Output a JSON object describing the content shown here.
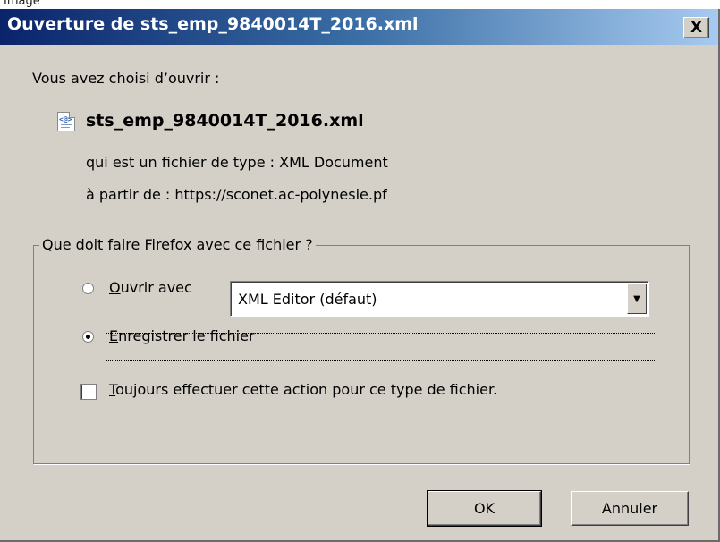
{
  "window": {
    "partial_label": "Image",
    "title": "Ouverture de sts_emp_9840014T_2016.xml",
    "close_glyph": "X"
  },
  "intro": "Vous avez choisi d’ouvrir :",
  "file": {
    "icon": "xml-file-icon",
    "icon_glyph": "<@>",
    "name": "sts_emp_9840014T_2016.xml",
    "type_label": "qui est un fichier de type :",
    "type_value": "XML Document",
    "source_label": "à partir de :",
    "source_value": "https://sconet.ac-polynesie.pf"
  },
  "group": {
    "legend": "Que doit faire Firefox avec ce fichier ?",
    "open_with": {
      "access_key": "O",
      "label_rest": "uvrir avec",
      "selected": false,
      "app_value": "XML Editor (défaut)"
    },
    "save": {
      "access_key": "E",
      "label_rest": "nregistrer le fichier",
      "selected": true
    },
    "always": {
      "access_key": "T",
      "label_rest": "oujours effectuer cette action pour ce type de fichier.",
      "checked": false
    }
  },
  "buttons": {
    "ok": "OK",
    "cancel": "Annuler"
  },
  "colors": {
    "title_gradient_start": "#0a246a",
    "title_gradient_end": "#a6caf0",
    "dialog_bg": "#d4d0c8"
  }
}
